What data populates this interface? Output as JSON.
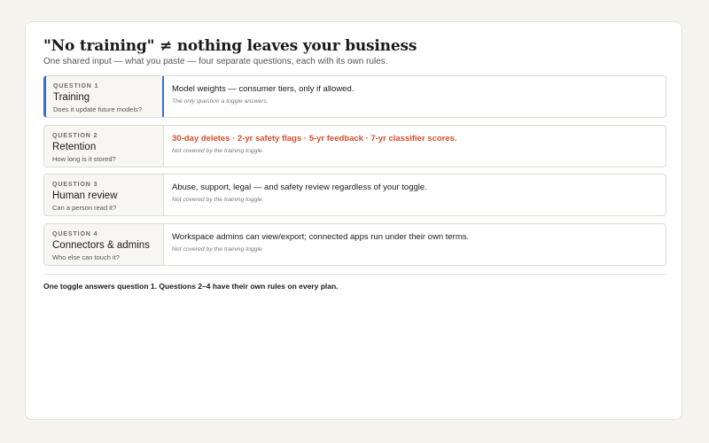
{
  "header": {
    "title": "\"No training\" ≠ nothing leaves your business",
    "subtitle": "One shared input — what you paste — four separate questions, each with its own rules."
  },
  "rows": [
    {
      "number": "QUESTION 1",
      "name": "Training",
      "question": "Does it update future models?",
      "answer": "Model weights — consumer tiers, only if allowed.",
      "note": "The only question a toggle answers."
    },
    {
      "number": "QUESTION 2",
      "name": "Retention",
      "question": "How long is it stored?",
      "answer": "30-day deletes · 2-yr safety flags · 5-yr feedback · 7-yr classifier scores.",
      "note": "Not covered by the training toggle."
    },
    {
      "number": "QUESTION 3",
      "name": "Human review",
      "question": "Can a person read it?",
      "answer": "Abuse, support, legal — and safety review regardless of your toggle.",
      "note": "Not covered by the training toggle."
    },
    {
      "number": "QUESTION 4",
      "name": "Connectors & admins",
      "question": "Who else can touch it?",
      "answer": "Workspace admins can view/export; connected apps run under their own terms.",
      "note": "Not covered by the training toggle."
    }
  ],
  "footer": {
    "text": "One toggle answers question 1. Questions 2–4 have their own rules on every plan."
  },
  "colors": {
    "accent": "#3b6fd8",
    "warning": "#d94e2a"
  }
}
